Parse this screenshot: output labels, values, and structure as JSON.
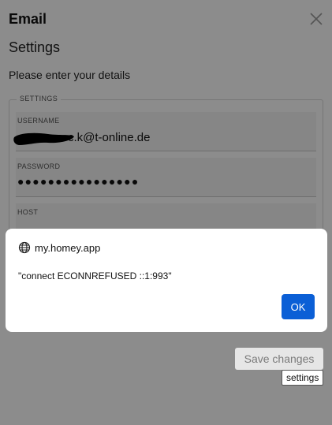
{
  "window": {
    "title": "Email"
  },
  "page": {
    "subtitle": "Settings",
    "prompt": "Please enter your details",
    "section_legend": "SETTINGS"
  },
  "fields": {
    "username": {
      "label": "USERNAME",
      "value": "c.k@t-online.de"
    },
    "password": {
      "label": "PASSWORD",
      "value": "●●●●●●●●●●●●●●●●"
    },
    "host": {
      "label": "HOST",
      "value": ""
    }
  },
  "actions": {
    "save_label": "Save changes"
  },
  "tooltip": {
    "text": "settings"
  },
  "dialog": {
    "origin": "my.homey.app",
    "message": "\"connect ECONNREFUSED ::1:993\"",
    "ok_label": "OK"
  },
  "colors": {
    "primary": "#0b5fd6",
    "overlay": "rgba(0,0,0,0.45)"
  },
  "icons": {
    "close": "close-icon",
    "origin": "globe-icon"
  }
}
